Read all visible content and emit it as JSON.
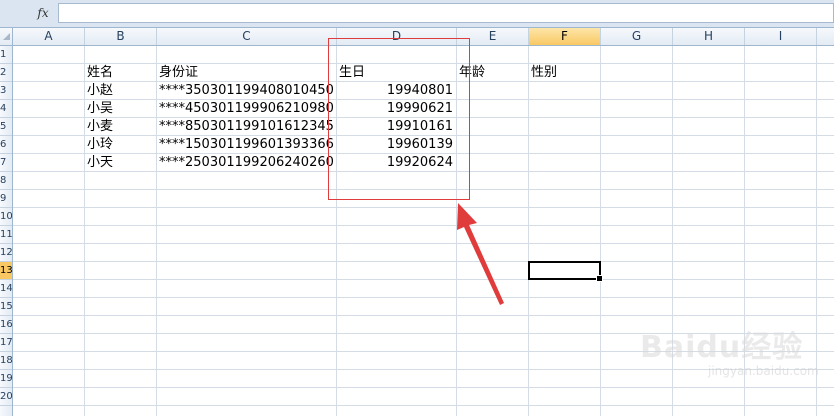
{
  "formula_bar": {
    "fx_label": "fx",
    "value": ""
  },
  "columns": [
    {
      "key": "A",
      "label": "A"
    },
    {
      "key": "B",
      "label": "B"
    },
    {
      "key": "C",
      "label": "C"
    },
    {
      "key": "D",
      "label": "D"
    },
    {
      "key": "E",
      "label": "E"
    },
    {
      "key": "F",
      "label": "F"
    },
    {
      "key": "G",
      "label": "G"
    },
    {
      "key": "H",
      "label": "H"
    },
    {
      "key": "I",
      "label": "I"
    }
  ],
  "row_labels": [
    "1",
    "2",
    "3",
    "4",
    "5",
    "6",
    "7",
    "8",
    "9",
    "10",
    "11",
    "12",
    "13",
    "14",
    "15",
    "16",
    "17",
    "18",
    "19",
    "20"
  ],
  "selected": {
    "column": "F",
    "row": "13"
  },
  "sheet": {
    "headers": {
      "name": "姓名",
      "id_card": "身份证",
      "birthday": "生日",
      "age": "年龄",
      "gender": "性别"
    },
    "rows": [
      {
        "name": "小赵",
        "id_card": "****350301199408010450",
        "birthday": "19940801"
      },
      {
        "name": "小吴",
        "id_card": "****450301199906210980",
        "birthday": "19990621"
      },
      {
        "name": "小麦",
        "id_card": "****850301199101612345",
        "birthday": "19910161"
      },
      {
        "name": "小玲",
        "id_card": "****150301199601393366",
        "birthday": "19960139"
      },
      {
        "name": "小天",
        "id_card": "****250301199206240260",
        "birthday": "19920624"
      }
    ]
  },
  "colors": {
    "annotation": "#e03c3c",
    "selection_header": "#f9c863",
    "gridline": "#d4dce5"
  },
  "watermark": {
    "brand": "Baidu经验",
    "site": "jingyan.baidu.com"
  }
}
